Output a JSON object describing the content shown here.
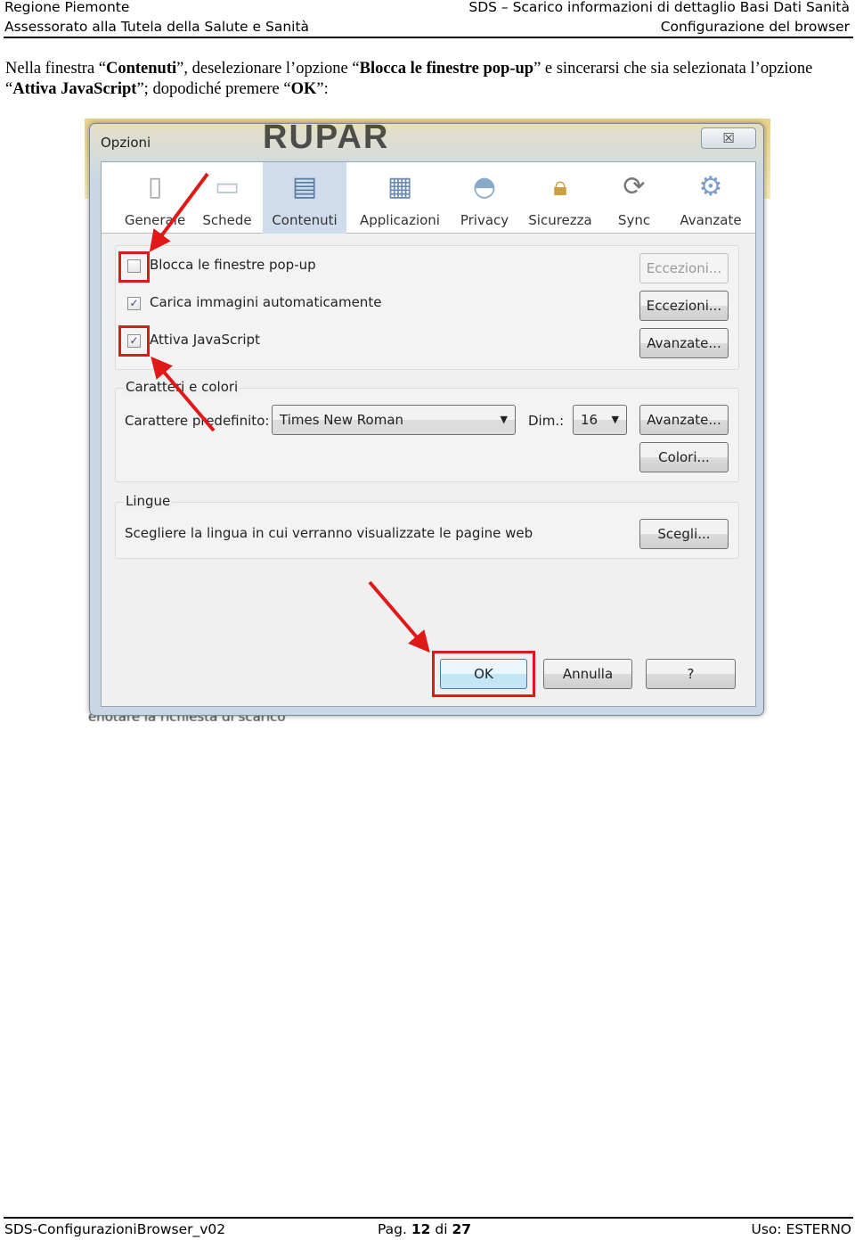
{
  "header": {
    "org": "Regione Piemonte",
    "dept": "Assessorato alla Tutela della Salute e Sanità",
    "doc_title": "SDS – Scarico informazioni di dettaglio Basi Dati Sanità",
    "section": "Configurazione del browser"
  },
  "instruction": {
    "p1": "Nella finestra “",
    "b1": "Contenuti",
    "p2": "”, deselezionare l’opzione “",
    "b2": "Blocca le finestre pop-up",
    "p3": "” e sincerarsi che sia selezionata l’opzione “",
    "b3": "Attiva JavaScript",
    "p4": "”; dopodiché premere “",
    "b4": "OK",
    "p5": "”:"
  },
  "screenshot": {
    "background_text": "RUPAR",
    "background_caption": "enotare la richiesta di scarico",
    "dialog": {
      "title": "Opzioni",
      "close_glyph": "☒",
      "tabs": [
        {
          "label": "Generale",
          "icon": "switch-icon"
        },
        {
          "label": "Schede",
          "icon": "folder-tabs-icon"
        },
        {
          "label": "Contenuti",
          "icon": "content-icon",
          "selected": true
        },
        {
          "label": "Applicazioni",
          "icon": "applications-icon"
        },
        {
          "label": "Privacy",
          "icon": "mask-icon"
        },
        {
          "label": "Sicurezza",
          "icon": "padlock-icon"
        },
        {
          "label": "Sync",
          "icon": "sync-icon"
        },
        {
          "label": "Avanzate",
          "icon": "gear-icon"
        }
      ],
      "options": [
        {
          "label": "Blocca le finestre pop-up",
          "checked": false,
          "button": "Eccezioni...",
          "button_disabled": true
        },
        {
          "label": "Carica immagini automaticamente",
          "checked": true,
          "button": "Eccezioni..."
        },
        {
          "label": "Attiva JavaScript",
          "checked": true,
          "button": "Avanzate..."
        }
      ],
      "fonts": {
        "legend": "Caratteri e colori",
        "default_label": "Carattere predefinito:",
        "font_value": "Times New Roman",
        "size_label": "Dim.:",
        "size_value": "16",
        "advanced_button": "Avanzate...",
        "colors_button": "Colori..."
      },
      "languages": {
        "legend": "Lingue",
        "text": "Scegliere la lingua in cui verranno visualizzate le pagine web",
        "choose_button": "Scegli..."
      },
      "buttons": {
        "ok": "OK",
        "cancel": "Annulla",
        "help": "?"
      },
      "highlight_color": "#e01818"
    }
  },
  "footer": {
    "doc_id": "SDS-ConfigurazioniBrowser_v02",
    "page_prefix": "Pag.",
    "page": "12",
    "of": "di",
    "total": "27",
    "usage": "Uso: ESTERNO"
  }
}
